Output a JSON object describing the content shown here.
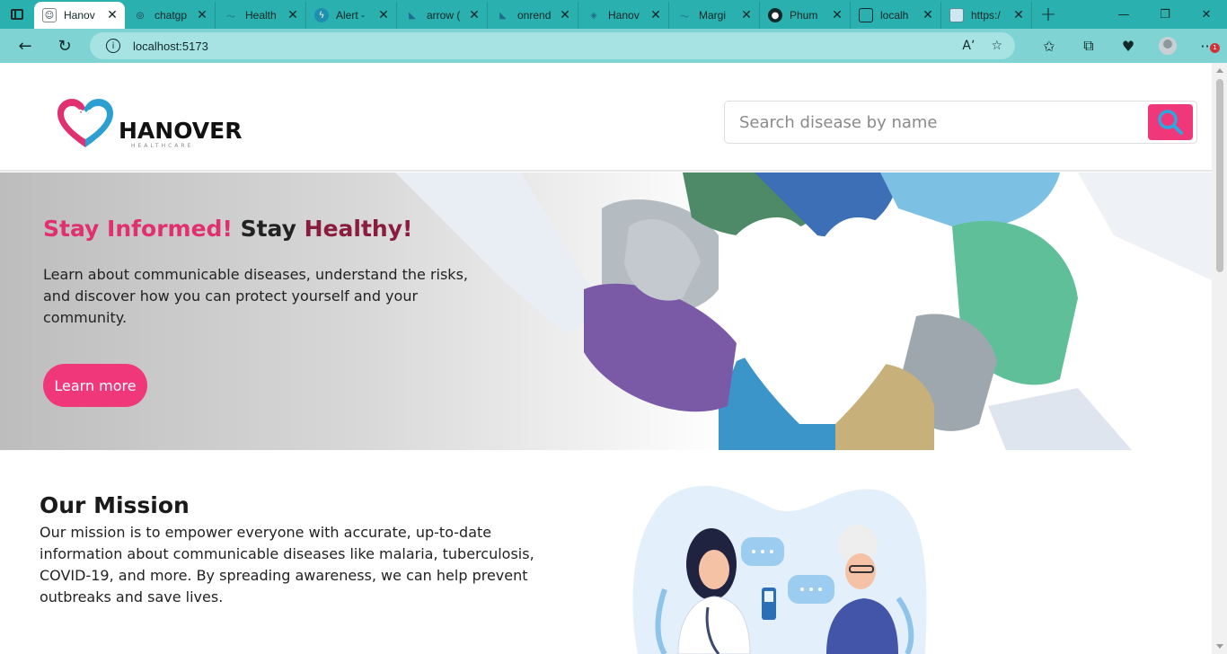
{
  "browser": {
    "tabs": [
      {
        "title": "Hanov",
        "active": true
      },
      {
        "title": "chatgp",
        "active": false
      },
      {
        "title": "Health",
        "active": false
      },
      {
        "title": "Alert -",
        "active": false
      },
      {
        "title": "arrow (",
        "active": false
      },
      {
        "title": "onrend",
        "active": false
      },
      {
        "title": "Hanov",
        "active": false
      },
      {
        "title": "Margi",
        "active": false
      },
      {
        "title": "Phum",
        "active": false
      },
      {
        "title": "localh",
        "active": false
      },
      {
        "title": "https:/",
        "active": false
      }
    ],
    "url": "localhost:5173",
    "notification_count": "1"
  },
  "site": {
    "logo_name": "HANOVER",
    "logo_sub": "HEALTHCARE",
    "search_placeholder": "Search disease by name",
    "brand_color": "#f0377a"
  },
  "hero": {
    "title_part1": "Stay Informed!",
    "title_part2": "Stay",
    "title_part3": "Healthy!",
    "text": "Learn about communicable diseases, understand the risks, and discover how you can protect yourself and your community.",
    "button_label": "Learn more"
  },
  "mission": {
    "heading": "Our Mission",
    "text": "Our mission is to empower everyone with accurate, up-to-date information about communicable diseases like malaria, tuberculosis, COVID-19, and more. By spreading awareness, we can help prevent outbreaks and save lives."
  }
}
